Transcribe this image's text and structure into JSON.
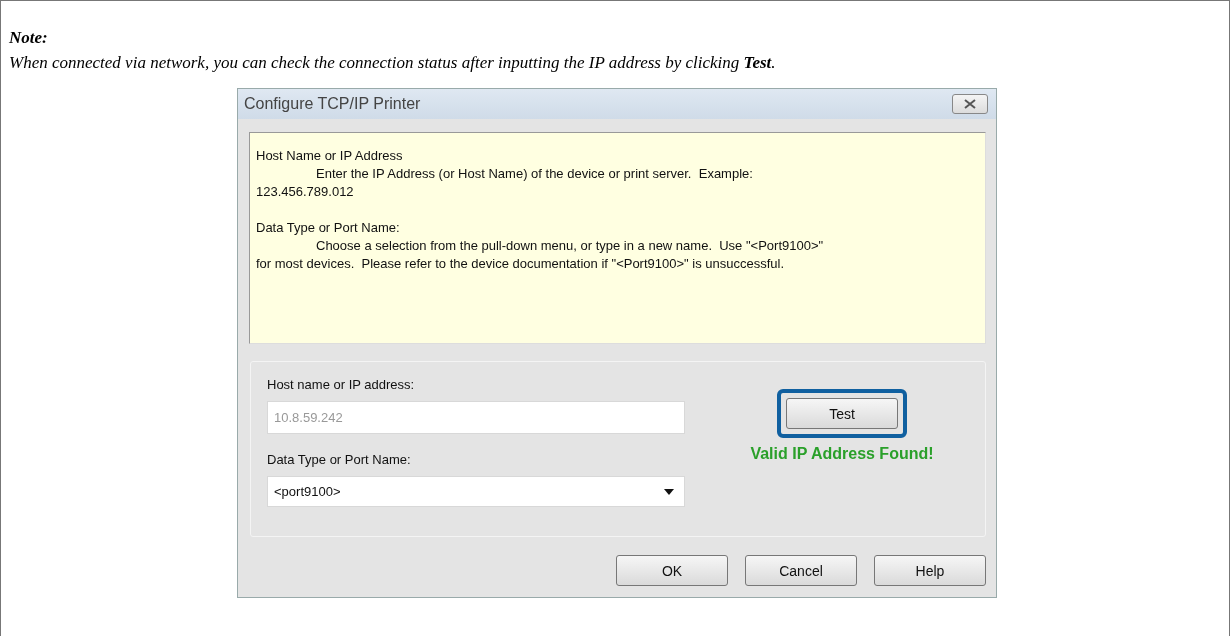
{
  "note": {
    "heading": "Note:",
    "text": "When connected via network, you can check the connection status after inputting the IP address by clicking **Test**."
  },
  "dialog": {
    "title": "Configure TCP/IP Printer",
    "help_sections": [
      {
        "heading": "Host Name or IP Address",
        "lines": [
          "Enter the IP Address (or Host Name) of the device or print server.  Example:",
          "123.456.789.012"
        ]
      },
      {
        "heading": "Data Type or Port Name:",
        "lines": [
          "Choose a selection from the pull-down menu, or type in a new name.  Use \"<Port9100>\"",
          "for most devices.  Please refer to the device documentation if \"<Port9100>\" is unsuccessful."
        ]
      }
    ],
    "host_label": "Host name or IP address:",
    "host_value": "10.8.59.242",
    "port_label": "Data Type or Port Name:",
    "port_value": "<port9100>",
    "test_button": {
      "label": "Test",
      "highlighted": true
    },
    "status": "Valid IP Address Found!",
    "buttons": [
      "OK",
      "Cancel",
      "Help"
    ]
  }
}
